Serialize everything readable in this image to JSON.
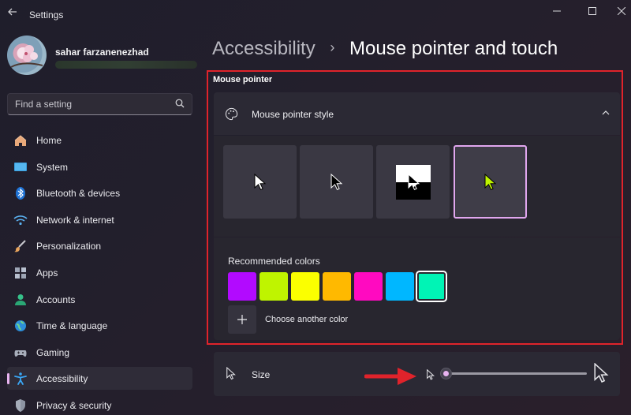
{
  "window": {
    "app_title": "Settings"
  },
  "profile": {
    "name": "sahar farzanenezhad"
  },
  "search": {
    "placeholder": "Find a setting"
  },
  "sidebar": {
    "items": [
      {
        "label": "Home",
        "icon": "home-icon"
      },
      {
        "label": "System",
        "icon": "system-icon"
      },
      {
        "label": "Bluetooth & devices",
        "icon": "bluetooth-icon"
      },
      {
        "label": "Network & internet",
        "icon": "wifi-icon"
      },
      {
        "label": "Personalization",
        "icon": "brush-icon"
      },
      {
        "label": "Apps",
        "icon": "apps-icon"
      },
      {
        "label": "Accounts",
        "icon": "accounts-icon"
      },
      {
        "label": "Time & language",
        "icon": "globe-icon"
      },
      {
        "label": "Gaming",
        "icon": "gamepad-icon"
      },
      {
        "label": "Accessibility",
        "icon": "accessibility-icon",
        "active": true
      },
      {
        "label": "Privacy & security",
        "icon": "shield-icon"
      }
    ]
  },
  "breadcrumb": {
    "parent": "Accessibility",
    "separator": "›",
    "current": "Mouse pointer and touch"
  },
  "mouse_pointer": {
    "section_title": "Mouse pointer",
    "style_header": "Mouse pointer style",
    "styles": [
      {
        "name": "white",
        "selected": false
      },
      {
        "name": "black",
        "selected": false
      },
      {
        "name": "inverted",
        "selected": false
      },
      {
        "name": "custom",
        "selected": true
      }
    ],
    "colors_label": "Recommended colors",
    "colors": [
      "#b20aff",
      "#bff400",
      "#fbff00",
      "#ffb900",
      "#ff0ac0",
      "#00b7ff",
      "#00f4b5"
    ],
    "selected_color": "#00f4b5",
    "custom_pointer_color": "#bff400",
    "add_color_label": "Choose another color"
  },
  "size": {
    "label": "Size",
    "value_fraction": 0.0
  },
  "accent": "#e8b3f0"
}
